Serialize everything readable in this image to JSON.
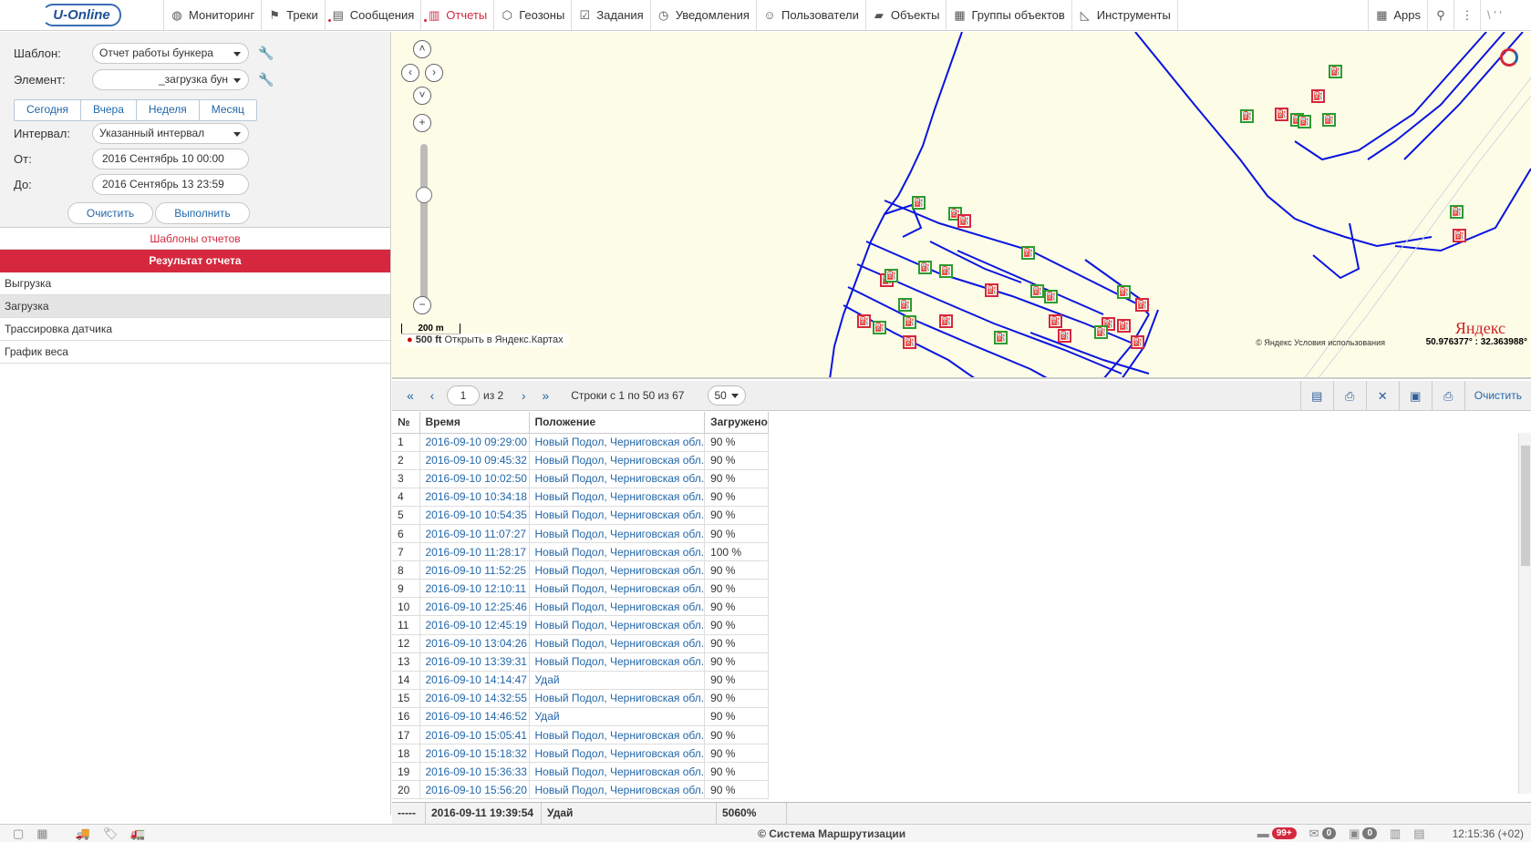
{
  "app": {
    "brand": "U-Online"
  },
  "nav": [
    {
      "label": "Мониторинг",
      "icon": "globe-icon"
    },
    {
      "label": "Треки",
      "icon": "flag-icon"
    },
    {
      "label": "Сообщения",
      "icon": "messages-icon"
    },
    {
      "label": "Отчеты",
      "icon": "reports-icon",
      "active": true
    },
    {
      "label": "Геозоны",
      "icon": "geofence-icon"
    },
    {
      "label": "Задания",
      "icon": "tasks-icon"
    },
    {
      "label": "Уведомления",
      "icon": "alarm-icon"
    },
    {
      "label": "Пользователи",
      "icon": "user-icon"
    },
    {
      "label": "Объекты",
      "icon": "truck-icon"
    },
    {
      "label": "Группы объектов",
      "icon": "groups-icon"
    },
    {
      "label": "Инструменты",
      "icon": "tools-icon"
    }
  ],
  "topright": {
    "apps_label": "Apps",
    "user": "\\ '  '"
  },
  "form": {
    "template_label": "Шаблон:",
    "template_value": "Отчет работы бункера",
    "element_label": "Элемент:",
    "element_value": "_загрузка бун",
    "periods": [
      "Сегодня",
      "Вчера",
      "Неделя",
      "Месяц"
    ],
    "interval_label": "Интервал:",
    "interval_value": "Указанный интервал",
    "from_label": "От:",
    "from_value": "2016 Сентябрь 10 00:00",
    "to_label": "До:",
    "to_value": "2016 Сентябрь 13 23:59",
    "clear_label": "Очистить",
    "run_label": "Выполнить"
  },
  "templates_header": "Шаблоны отчетов",
  "result_header": "Результат отчета",
  "result_items": [
    "Выгрузка",
    "Загрузка",
    "Трассировка датчика",
    "График веса"
  ],
  "map": {
    "scale_m": "200 m",
    "scale_ft": "500 ft",
    "open_link": "Открыть в Яндекс.Картах",
    "logo": "Яндекс",
    "copyright": "© Яндекс Условия использования",
    "coords": "50.976377° : 32.363988°"
  },
  "toolbar": {
    "page": "1",
    "of_pages": "из 2",
    "rows_info": "Строки с 1 по 50 из 67",
    "per_page": "50",
    "clear_label": "Очистить"
  },
  "table": {
    "columns": [
      "№",
      "Время",
      "Положение",
      "Загружено"
    ],
    "rows": [
      [
        "1",
        "2016-09-10 09:29:00",
        "Новый Подол, Черниговская обл.",
        "90 %"
      ],
      [
        "2",
        "2016-09-10 09:45:32",
        "Новый Подол, Черниговская обл.",
        "90 %"
      ],
      [
        "3",
        "2016-09-10 10:02:50",
        "Новый Подол, Черниговская обл.",
        "90 %"
      ],
      [
        "4",
        "2016-09-10 10:34:18",
        "Новый Подол, Черниговская обл.",
        "90 %"
      ],
      [
        "5",
        "2016-09-10 10:54:35",
        "Новый Подол, Черниговская обл.",
        "90 %"
      ],
      [
        "6",
        "2016-09-10 11:07:27",
        "Новый Подол, Черниговская обл.",
        "90 %"
      ],
      [
        "7",
        "2016-09-10 11:28:17",
        "Новый Подол, Черниговская обл.",
        "100 %"
      ],
      [
        "8",
        "2016-09-10 11:52:25",
        "Новый Подол, Черниговская обл.",
        "90 %"
      ],
      [
        "9",
        "2016-09-10 12:10:11",
        "Новый Подол, Черниговская обл.",
        "90 %"
      ],
      [
        "10",
        "2016-09-10 12:25:46",
        "Новый Подол, Черниговская обл.",
        "90 %"
      ],
      [
        "11",
        "2016-09-10 12:45:19",
        "Новый Подол, Черниговская обл.",
        "90 %"
      ],
      [
        "12",
        "2016-09-10 13:04:26",
        "Новый Подол, Черниговская обл.",
        "90 %"
      ],
      [
        "13",
        "2016-09-10 13:39:31",
        "Новый Подол, Черниговская обл.",
        "90 %"
      ],
      [
        "14",
        "2016-09-10 14:14:47",
        "Удай",
        "90 %"
      ],
      [
        "15",
        "2016-09-10 14:32:55",
        "Новый Подол, Черниговская обл.",
        "90 %"
      ],
      [
        "16",
        "2016-09-10 14:46:52",
        "Удай",
        "90 %"
      ],
      [
        "17",
        "2016-09-10 15:05:41",
        "Новый Подол, Черниговская обл.",
        "90 %"
      ],
      [
        "18",
        "2016-09-10 15:18:32",
        "Новый Подол, Черниговская обл.",
        "90 %"
      ],
      [
        "19",
        "2016-09-10 15:36:33",
        "Новый Подол, Черниговская обл.",
        "90 %"
      ],
      [
        "20",
        "2016-09-10 15:56:20",
        "Новый Подол, Черниговская обл.",
        "90 %"
      ]
    ],
    "totals": [
      "-----",
      "2016-09-11 19:39:54",
      "Удай",
      "5060%"
    ]
  },
  "status": {
    "copyright": "© Система Маршрутизации",
    "notif_badge": "99+",
    "mail_badge": "0",
    "photo_badge": "0",
    "clock": "12:15:36 (+02)"
  },
  "colors": {
    "accent": "#d5283e",
    "link": "#2367a8",
    "track": "#0a14e0"
  }
}
